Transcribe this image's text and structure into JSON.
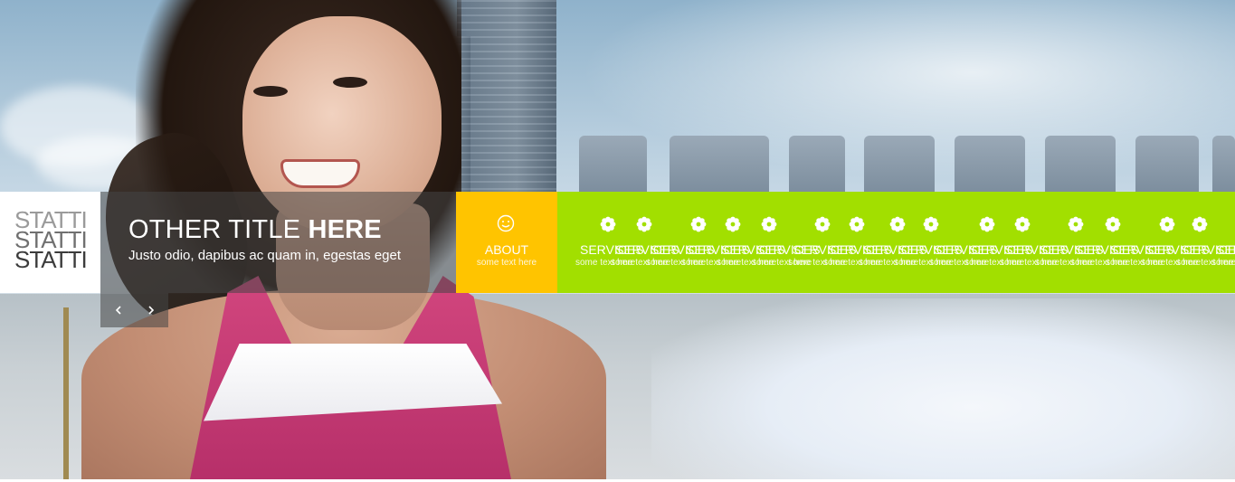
{
  "logo": {
    "lines": [
      "STATTI",
      "STATTI",
      "STATTI"
    ]
  },
  "slide": {
    "title_light": "OTHER TITLE ",
    "title_bold": "HERE",
    "subtitle": "Justo odio, dapibus ac quam in, egestas eget",
    "prev_icon": "chevron-left",
    "next_icon": "chevron-right"
  },
  "tiles": {
    "about": {
      "icon": "smiley-icon",
      "label": "ABOUT",
      "sub": "some text here",
      "color": "#ffc400"
    },
    "services": {
      "icon": "flower-gear-icon",
      "label": "SERVICES",
      "sub": "some text here",
      "color": "#a2df00",
      "count": 14
    }
  }
}
